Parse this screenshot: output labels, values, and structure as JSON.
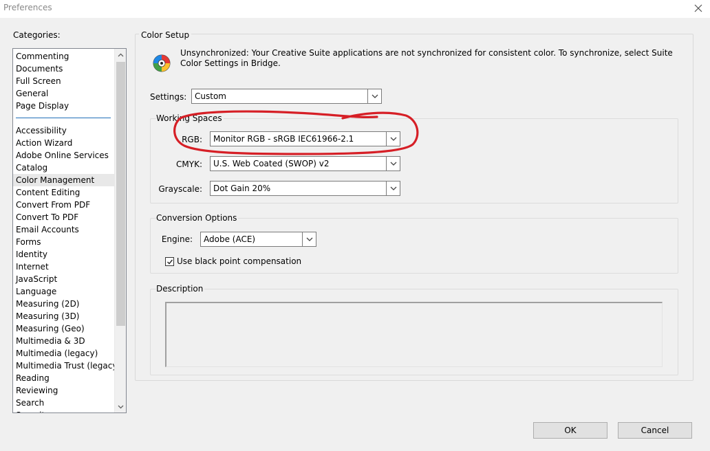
{
  "window": {
    "title": "Preferences",
    "close_glyph": "✕"
  },
  "categories": {
    "label": "Categories:",
    "top_items": [
      "Commenting",
      "Documents",
      "Full Screen",
      "General",
      "Page Display"
    ],
    "items": [
      "Accessibility",
      "Action Wizard",
      "Adobe Online Services",
      "Catalog",
      "Color Management",
      "Content Editing",
      "Convert From PDF",
      "Convert To PDF",
      "Email Accounts",
      "Forms",
      "Identity",
      "Internet",
      "JavaScript",
      "Language",
      "Measuring (2D)",
      "Measuring (3D)",
      "Measuring (Geo)",
      "Multimedia & 3D",
      "Multimedia (legacy)",
      "Multimedia Trust (legacy)",
      "Reading",
      "Reviewing",
      "Search",
      "Security"
    ],
    "selected": "Color Management"
  },
  "color_setup": {
    "title": "Color Setup",
    "sync_message": "Unsynchronized: Your Creative Suite applications are not synchronized for consistent color. To synchronize, select Suite Color Settings in Bridge.",
    "settings_label": "Settings:",
    "settings_value": "Custom",
    "working_spaces": {
      "title": "Working Spaces",
      "rgb_label": "RGB:",
      "rgb_value": "Monitor RGB - sRGB IEC61966-2.1",
      "cmyk_label": "CMYK:",
      "cmyk_value": "U.S. Web Coated (SWOP) v2",
      "gray_label": "Grayscale:",
      "gray_value": "Dot Gain 20%"
    },
    "conversion": {
      "title": "Conversion Options",
      "engine_label": "Engine:",
      "engine_value": "Adobe (ACE)",
      "bpc_label": "Use black point compensation",
      "bpc_checked": true
    },
    "description": {
      "title": "Description"
    }
  },
  "buttons": {
    "ok": "OK",
    "cancel": "Cancel"
  },
  "colors": {
    "annotation_red": "#d61f26",
    "selection": "#e8e8e8",
    "separator": "#1f6fb8"
  },
  "icons": {
    "sync": "color-wheel-icon",
    "dropdown": "chevron-down-icon",
    "check": "checkmark-icon"
  }
}
